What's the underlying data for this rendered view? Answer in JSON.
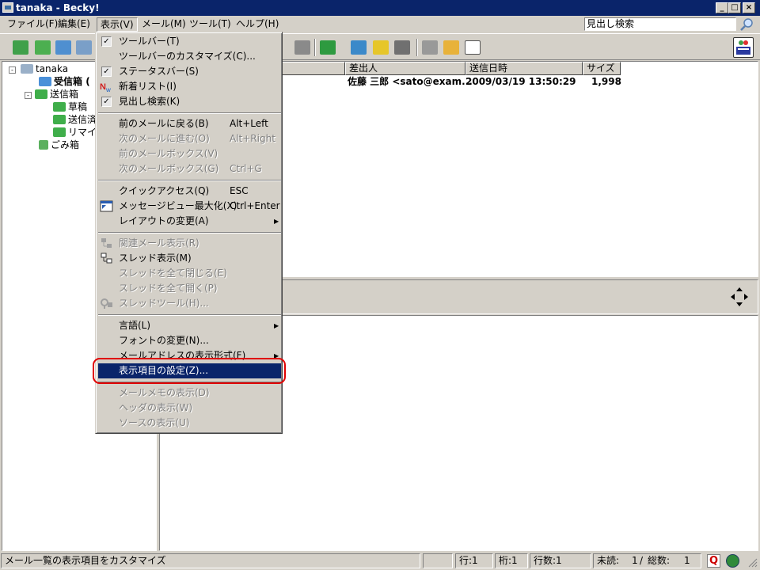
{
  "window": {
    "title": "tanaka - Becky!"
  },
  "menubar": [
    {
      "label": "ファイル(F)"
    },
    {
      "label": "編集(E)"
    },
    {
      "label": "表示(V)"
    },
    {
      "label": "メール(M)"
    },
    {
      "label": "ツール(T)"
    },
    {
      "label": "ヘルプ(H)"
    }
  ],
  "search": {
    "value": "見出し検索"
  },
  "tree": {
    "account": "tanaka",
    "inbox": "受信箱",
    "inbox_suffix": "(",
    "sent_group": "送信箱",
    "drafts": "草稿",
    "sent": "送信済",
    "reminder": "リマイン",
    "trash": "ごみ箱"
  },
  "list": {
    "columns": [
      "差出人",
      "送信日時",
      "サイズ"
    ],
    "rows": [
      {
        "from": "佐藤 三郎 <sato@exam...",
        "date": "2009/03/19 13:50:29",
        "size": "1,998"
      }
    ]
  },
  "view_menu": {
    "items": [
      {
        "label": "ツールバー(T)",
        "check": true
      },
      {
        "label": "ツールバーのカスタマイズ(C)..."
      },
      {
        "label": "ステータスバー(S)",
        "check": true
      },
      {
        "label": "新着リスト(I)",
        "icon": "new-list-icon"
      },
      {
        "label": "見出し検索(K)",
        "check": true
      },
      {
        "label": "前のメールに戻る(B)",
        "shortcut": "Alt+Left"
      },
      {
        "label": "次のメールに進む(O)",
        "shortcut": "Alt+Right",
        "disabled": true
      },
      {
        "label": "前のメールボックス(V)",
        "disabled": true
      },
      {
        "label": "次のメールボックス(G)",
        "shortcut": "Ctrl+G",
        "disabled": true
      },
      {
        "label": "クイックアクセス(Q)",
        "shortcut": "ESC"
      },
      {
        "label": "メッセージビュー最大化(X)",
        "shortcut": "Ctrl+Enter",
        "icon": "maximize-icon"
      },
      {
        "label": "レイアウトの変更(A)",
        "submenu": true
      },
      {
        "label": "関連メール表示(R)",
        "disabled": true,
        "icon": "related-icon"
      },
      {
        "label": "スレッド表示(M)",
        "icon": "thread-icon"
      },
      {
        "label": "スレッドを全て閉じる(E)",
        "disabled": true
      },
      {
        "label": "スレッドを全て開く(P)",
        "disabled": true
      },
      {
        "label": "スレッドツール(H)...",
        "disabled": true,
        "icon": "thread-tool-icon"
      },
      {
        "label": "言語(L)",
        "submenu": true
      },
      {
        "label": "フォントの変更(N)..."
      },
      {
        "label": "メールアドレスの表示形式(F)",
        "submenu": true
      },
      {
        "label": "表示項目の設定(Z)...",
        "highlighted": true
      },
      {
        "label": "メールメモの表示(D)",
        "disabled": true
      },
      {
        "label": "ヘッダの表示(W)",
        "disabled": true
      },
      {
        "label": "ソースの表示(U)",
        "disabled": true
      }
    ]
  },
  "status": {
    "message": "メール一覧の表示項目をカスタマイズ",
    "line": "行:1",
    "col": "桁:1",
    "lines": "行数:1",
    "unread_label": "未読:",
    "unread": "1",
    "slash": "/",
    "total_label": "総数:",
    "total": "1"
  },
  "colors": {
    "titlebar": "#0a246a",
    "highlight": "#0a246a",
    "annotation": "#e00000"
  }
}
